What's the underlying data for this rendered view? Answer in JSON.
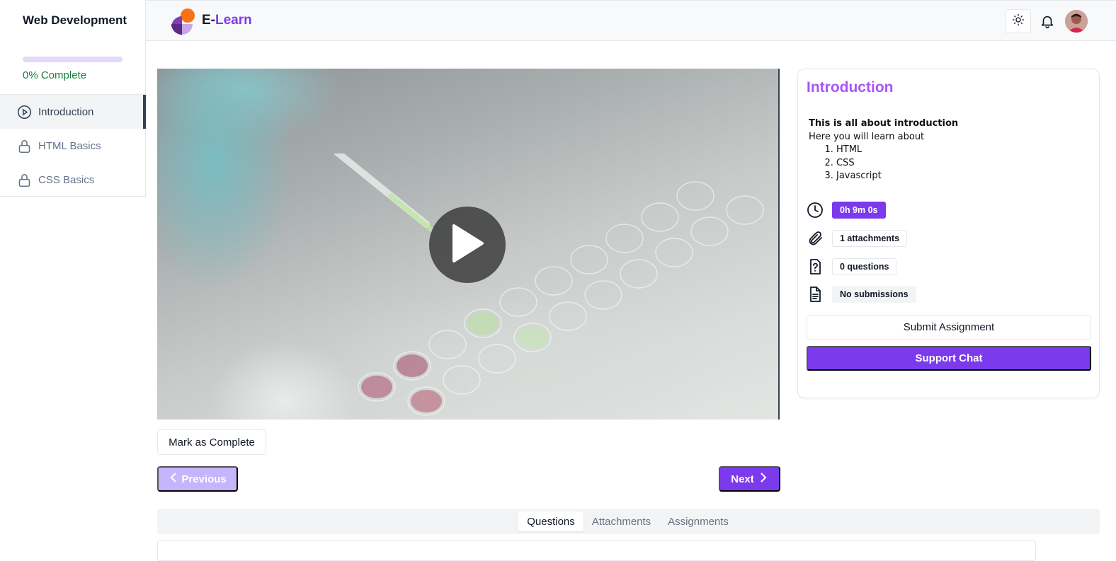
{
  "sidebar": {
    "course_title": "Web Development",
    "progress_percent": 0,
    "progress_text": "0% Complete",
    "chapters": [
      {
        "label": "Introduction",
        "icon": "play-circle-icon",
        "active": true
      },
      {
        "label": "HTML Basics",
        "icon": "lock-icon",
        "active": false
      },
      {
        "label": "CSS Basics",
        "icon": "lock-icon",
        "active": false
      }
    ]
  },
  "header": {
    "brand_prefix": "E-",
    "brand_suffix": "Learn",
    "icons": [
      "sun-icon",
      "bell-icon",
      "user-avatar"
    ]
  },
  "player": {
    "actions": {
      "mark_complete": "Mark as Complete",
      "previous": "Previous",
      "next": "Next"
    }
  },
  "tabs": [
    {
      "label": "Questions",
      "active": true
    },
    {
      "label": "Attachments",
      "active": false
    },
    {
      "label": "Assignments",
      "active": false
    }
  ],
  "info": {
    "title": "Introduction",
    "description_heading": "This is all about introduction",
    "description_intro": "Here you will learn about",
    "topics": [
      "HTML",
      "CSS",
      "Javascript"
    ],
    "duration": "0h 9m 0s",
    "attachments": "1 attachments",
    "questions": "0 questions",
    "submissions": "No submissions",
    "submit_label": "Submit Assignment",
    "support_label": "Support Chat"
  },
  "colors": {
    "accent": "#7c3aed",
    "accent_light": "#c4b5fd",
    "title_purple": "#a855f7",
    "progress_green": "#15803d",
    "logo_orange": "#f97316"
  }
}
